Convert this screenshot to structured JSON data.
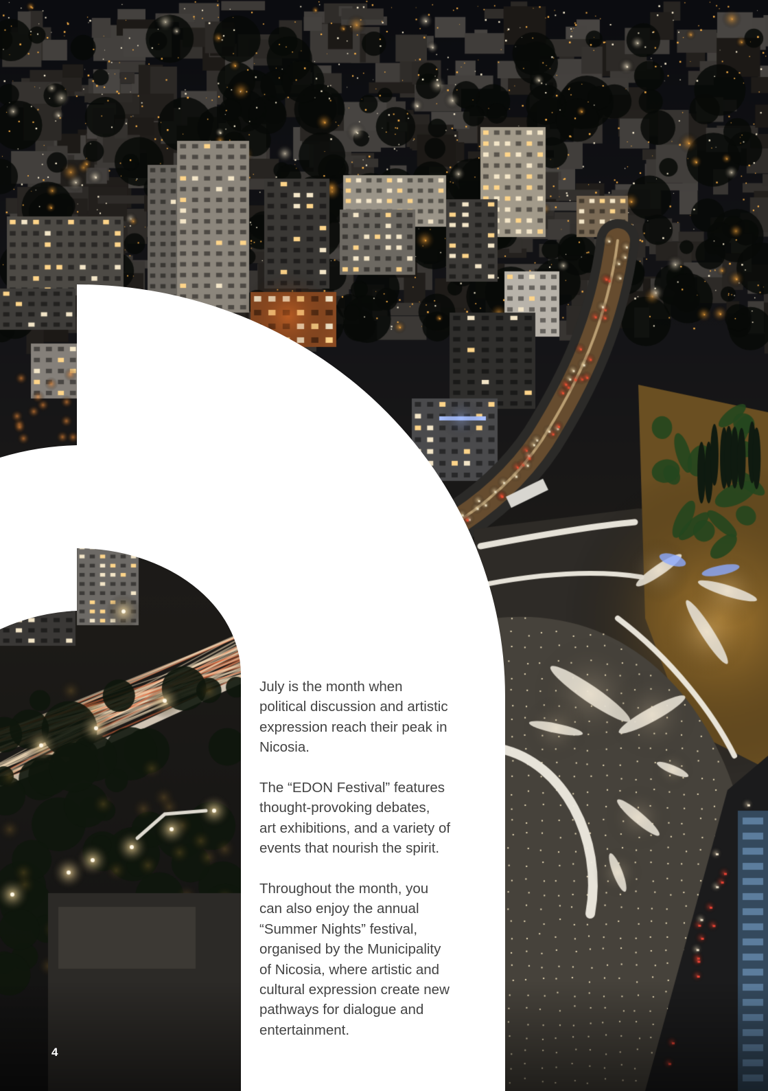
{
  "page": {
    "number": "4"
  },
  "body": {
    "paragraphs": [
      {
        "lines": [
          "July is the month when",
          "political discussion and artistic",
          "expression reach their peak in",
          "Nicosia."
        ]
      },
      {
        "lines": [
          "The “EDON Festival” features",
          "thought-provoking debates,",
          "art exhibitions, and a variety of",
          "events that nourish the spirit."
        ]
      },
      {
        "lines": [
          "Throughout the month, you",
          "can also enjoy the annual",
          "“Summer Nights” festival,",
          "organised by the Municipality",
          "of Nicosia, where artistic and",
          "cultural expression create new",
          "pathways for dialogue and",
          "entertainment."
        ]
      }
    ]
  },
  "colors": {
    "panel": "#ffffff",
    "body_text": "#424242",
    "page_number": "#ffffff"
  }
}
